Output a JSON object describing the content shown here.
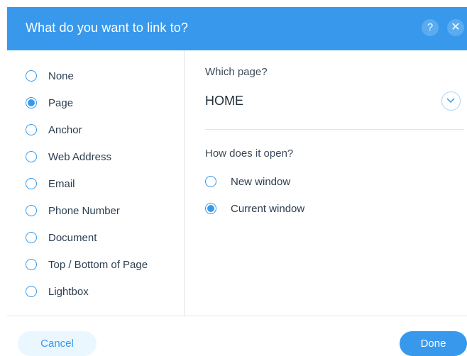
{
  "dialog": {
    "title": "What do you want to link to?",
    "help_icon": "?",
    "close_icon": "✕"
  },
  "link_types": [
    {
      "label": "None",
      "checked": false
    },
    {
      "label": "Page",
      "checked": true
    },
    {
      "label": "Anchor",
      "checked": false
    },
    {
      "label": "Web Address",
      "checked": false
    },
    {
      "label": "Email",
      "checked": false
    },
    {
      "label": "Phone Number",
      "checked": false
    },
    {
      "label": "Document",
      "checked": false
    },
    {
      "label": "Top / Bottom of Page",
      "checked": false
    },
    {
      "label": "Lightbox",
      "checked": false
    }
  ],
  "page_section": {
    "label": "Which page?",
    "selected": "HOME"
  },
  "open_section": {
    "label": "How does it open?",
    "options": [
      {
        "label": "New window",
        "checked": false
      },
      {
        "label": "Current window",
        "checked": true
      }
    ]
  },
  "footer": {
    "cancel_label": "Cancel",
    "done_label": "Done"
  },
  "colors": {
    "accent": "#3899ec",
    "cancel_bg": "#eaf7ff",
    "divider": "#dfe5eb"
  }
}
